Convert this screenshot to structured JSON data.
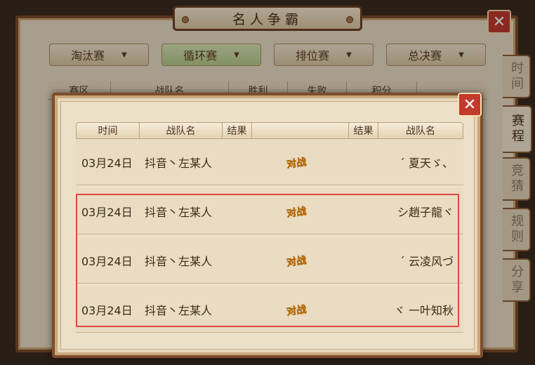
{
  "title": "名人争霸",
  "tabs": [
    {
      "label": "淘汰赛"
    },
    {
      "label": "循环赛"
    },
    {
      "label": "排位赛"
    },
    {
      "label": "总决赛"
    }
  ],
  "bg_header": [
    "赛区",
    "战队名",
    "胜利",
    "失败",
    "积分"
  ],
  "side_tabs": [
    {
      "label": "时间"
    },
    {
      "label": "赛程"
    },
    {
      "label": "竞猜"
    },
    {
      "label": "规则"
    },
    {
      "label": "分享"
    }
  ],
  "dialog": {
    "columns": [
      "时间",
      "战队名",
      "结果",
      "",
      "结果",
      "战队名"
    ],
    "vs_label": "对战",
    "rows": [
      {
        "time": "03月24日",
        "team1": "抖音丶左某人",
        "team2": "ˊ 夏天ゞ、"
      },
      {
        "time": "03月24日",
        "team1": "抖音丶左某人",
        "team2": "シ趙子龍ヾ"
      },
      {
        "time": "03月24日",
        "team1": "抖音丶左某人",
        "team2": "ˊ 云凌风づ"
      },
      {
        "time": "03月24日",
        "team1": "抖音丶左某人",
        "team2": "ヾ 一叶知秋"
      }
    ]
  },
  "colors": {
    "accent_red": "#e0463f",
    "frame_brown": "#7d4d2b",
    "active_tab": "#b4c987",
    "vs_gold": "#f2a21c"
  }
}
